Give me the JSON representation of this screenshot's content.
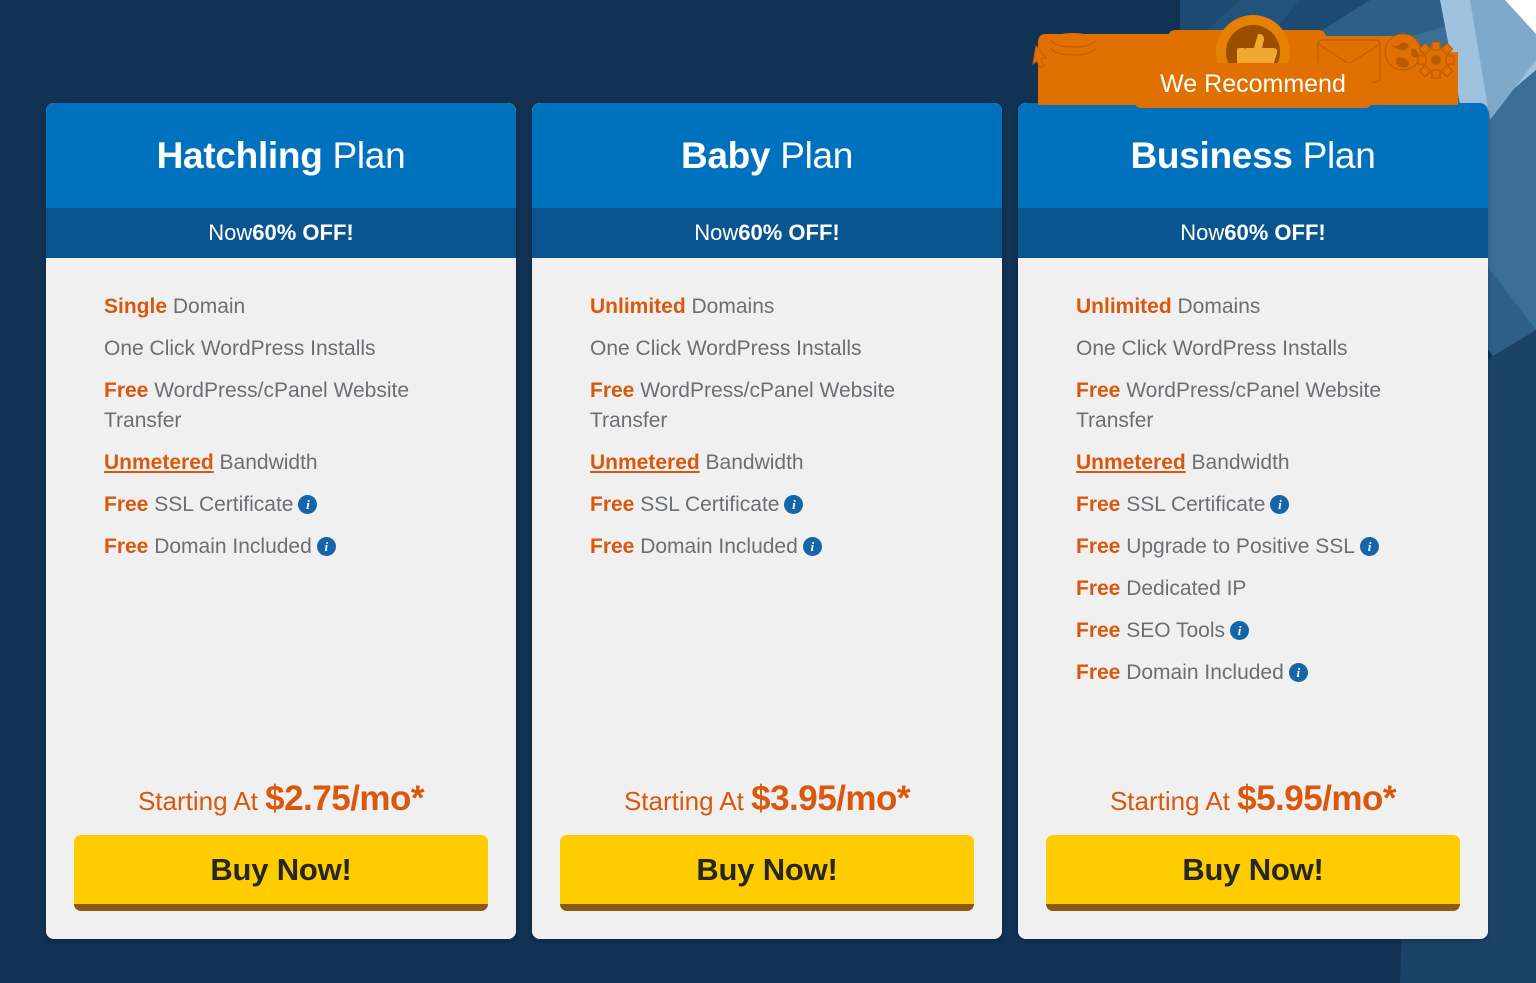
{
  "theme": {
    "background": "#123254",
    "card_bg": "#f0f0f0",
    "header_blue": "#0071bc",
    "promo_blue": "#0a5490",
    "accent_orange": "#d9580d",
    "badge_orange": "#e07000",
    "button_yellow": "#ffcc00",
    "button_shadow": "#8a5a11",
    "text_gray": "#6b6f73",
    "info_icon_blue": "#1565a8"
  },
  "badge": {
    "label": "We Recommend",
    "icon": "thumbs-up-icon",
    "decor_icons": [
      "coins-icon",
      "box-icon",
      "envelope-icon",
      "globe-icon",
      "gear-icon"
    ]
  },
  "plans": [
    {
      "name_strong": "Hatchling",
      "name_light": " Plan",
      "promo_pre": "Now ",
      "promo_strong": "60% OFF!",
      "features": [
        {
          "highlight": "Single",
          "underline": false,
          "rest": " Domain",
          "info": false
        },
        {
          "highlight": "",
          "underline": false,
          "rest": "One Click WordPress Installs",
          "info": false
        },
        {
          "highlight": "Free",
          "underline": false,
          "rest": " WordPress/cPanel Website Transfer",
          "info": false
        },
        {
          "highlight": "Unmetered",
          "underline": true,
          "rest": " Bandwidth",
          "info": false
        },
        {
          "highlight": "Free",
          "underline": false,
          "rest": " SSL Certificate",
          "info": true
        },
        {
          "highlight": "Free",
          "underline": false,
          "rest": " Domain Included",
          "info": true
        }
      ],
      "price_pre": "Starting At ",
      "price_amount": "$2.75/mo*",
      "buy_label": "Buy Now!",
      "recommended": false
    },
    {
      "name_strong": "Baby",
      "name_light": " Plan",
      "promo_pre": "Now ",
      "promo_strong": "60% OFF!",
      "features": [
        {
          "highlight": "Unlimited",
          "underline": false,
          "rest": " Domains",
          "info": false
        },
        {
          "highlight": "",
          "underline": false,
          "rest": "One Click WordPress Installs",
          "info": false
        },
        {
          "highlight": "Free",
          "underline": false,
          "rest": " WordPress/cPanel Website Transfer",
          "info": false
        },
        {
          "highlight": "Unmetered",
          "underline": true,
          "rest": " Bandwidth",
          "info": false
        },
        {
          "highlight": "Free",
          "underline": false,
          "rest": " SSL Certificate",
          "info": true
        },
        {
          "highlight": "Free",
          "underline": false,
          "rest": " Domain Included",
          "info": true
        }
      ],
      "price_pre": "Starting At ",
      "price_amount": "$3.95/mo*",
      "buy_label": "Buy Now!",
      "recommended": false
    },
    {
      "name_strong": "Business",
      "name_light": " Plan",
      "promo_pre": "Now ",
      "promo_strong": "60% OFF!",
      "features": [
        {
          "highlight": "Unlimited",
          "underline": false,
          "rest": " Domains",
          "info": false
        },
        {
          "highlight": "",
          "underline": false,
          "rest": "One Click WordPress Installs",
          "info": false
        },
        {
          "highlight": "Free",
          "underline": false,
          "rest": " WordPress/cPanel Website Transfer",
          "info": false
        },
        {
          "highlight": "Unmetered",
          "underline": true,
          "rest": " Bandwidth",
          "info": false
        },
        {
          "highlight": "Free",
          "underline": false,
          "rest": " SSL Certificate",
          "info": true
        },
        {
          "highlight": "Free",
          "underline": false,
          "rest": " Upgrade to Positive SSL",
          "info": true
        },
        {
          "highlight": "Free",
          "underline": false,
          "rest": " Dedicated IP",
          "info": false
        },
        {
          "highlight": "Free",
          "underline": false,
          "rest": " SEO Tools",
          "info": true
        },
        {
          "highlight": "Free",
          "underline": false,
          "rest": " Domain Included",
          "info": true
        }
      ],
      "price_pre": "Starting At ",
      "price_amount": "$5.95/mo*",
      "buy_label": "Buy Now!",
      "recommended": true
    }
  ]
}
